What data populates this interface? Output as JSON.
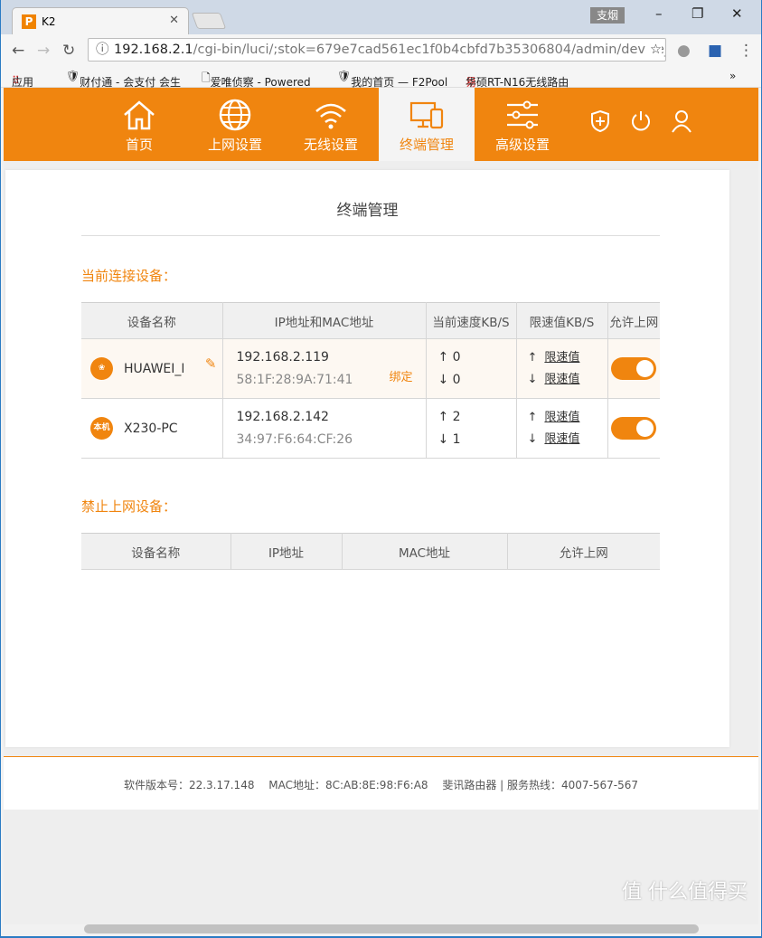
{
  "browser": {
    "tab_title": "K2",
    "user_badge": "支烟",
    "url_host": "192.168.2.1",
    "url_path": "/cgi-bin/luci/;stok=679e7cad561ec1f0b4cbfd7b35306804/admin/device_",
    "bookmarks": [
      "应用",
      "财付通 - 会支付 会生",
      "爱唯侦察 - Powered",
      "我的首页 — F2Pool",
      "华硕RT-N16无线路由"
    ]
  },
  "nav": {
    "items": [
      {
        "label": "首页",
        "icon": "home-icon"
      },
      {
        "label": "上网设置",
        "icon": "globe-icon"
      },
      {
        "label": "无线设置",
        "icon": "wifi-icon"
      },
      {
        "label": "终端管理",
        "icon": "devices-icon",
        "active": true
      },
      {
        "label": "高级设置",
        "icon": "sliders-icon"
      }
    ]
  },
  "page": {
    "title": "终端管理",
    "connected_label": "当前连接设备：",
    "blocked_label": "禁止上网设备："
  },
  "connected_table": {
    "headers": [
      "设备名称",
      "IP地址和MAC地址",
      "当前速度KB/S",
      "限速值KB/S",
      "允许上网"
    ],
    "rows": [
      {
        "icon_text": "",
        "name": "HUAWEI_M",
        "ip": "192.168.2.119",
        "mac": "58:1F:28:9A:71:41",
        "bind": "绑定",
        "up": "↑ 0",
        "down": "↓ 0",
        "limit_up": "限速值",
        "limit_down": "限速值",
        "allowed": true
      },
      {
        "icon_text": "本机",
        "name": "X230-PC",
        "ip": "192.168.2.142",
        "mac": "34:97:F6:64:CF:26",
        "up": "↑ 2",
        "down": "↓ 1",
        "limit_up": "限速值",
        "limit_down": "限速值",
        "allowed": true
      }
    ]
  },
  "blocked_table": {
    "headers": [
      "设备名称",
      "IP地址",
      "MAC地址",
      "允许上网"
    ]
  },
  "footer": {
    "text": "软件版本号：22.3.17.148　 MAC地址：8C:AB:8E:98:F6:A8　 斐讯路由器 | 服务热线：4007-567-567"
  },
  "watermark": "值 什么值得买",
  "colors": {
    "accent": "#f0850f"
  }
}
